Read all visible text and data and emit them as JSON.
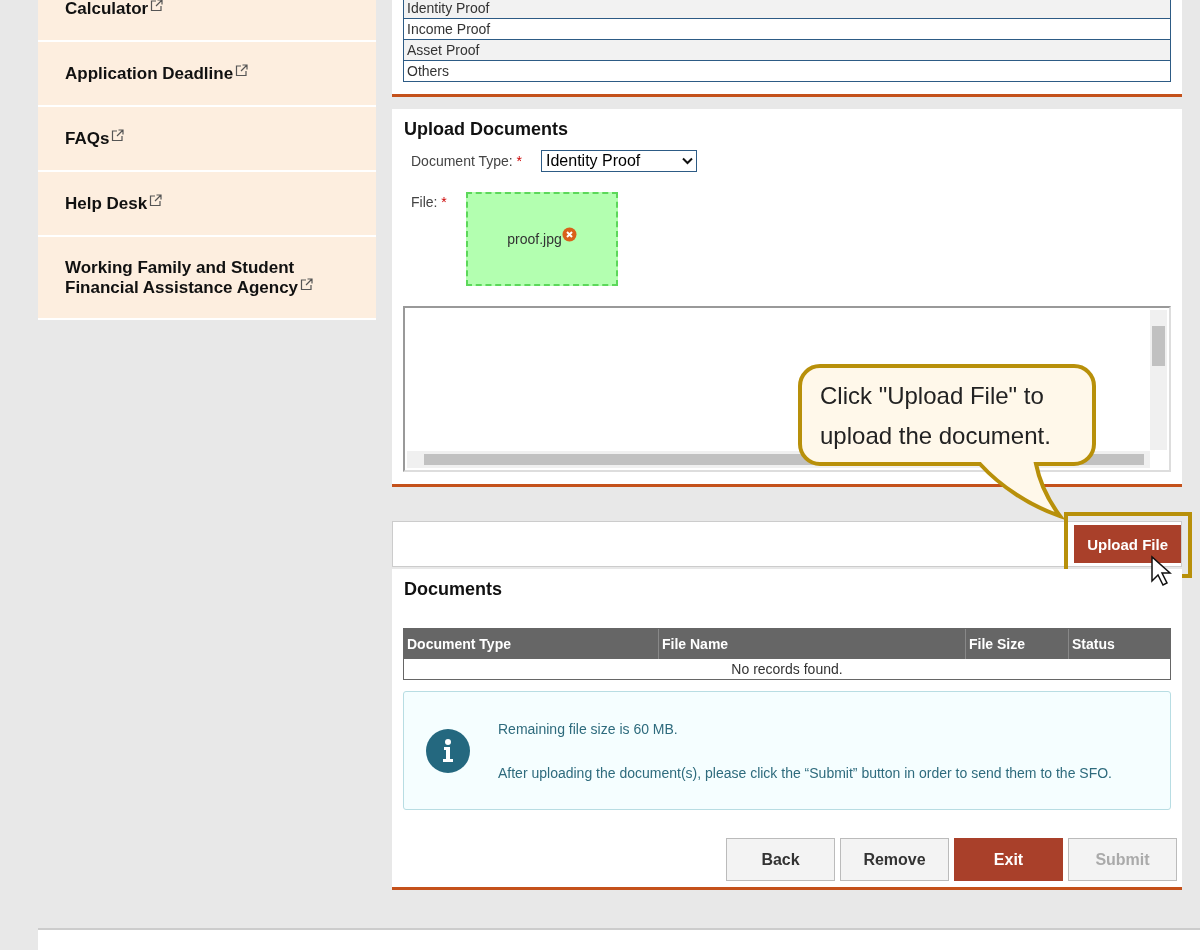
{
  "sidebar": {
    "items": [
      {
        "label": "Calculator"
      },
      {
        "label": "Application Deadline"
      },
      {
        "label": "FAQs"
      },
      {
        "label": "Help Desk"
      },
      {
        "label": "Working Family and Student Financial Assistance Agency"
      }
    ]
  },
  "document_types_table": {
    "rows": [
      "Identity Proof",
      "Income Proof",
      "Asset Proof",
      "Others"
    ]
  },
  "upload_documents": {
    "title": "Upload Documents",
    "document_type_label": "Document Type:",
    "document_type_value": "Identity Proof",
    "file_label": "File:",
    "required_mark": "*",
    "file_name": "proof.jpg"
  },
  "upload_button": "Upload File",
  "callout": "Click \"Upload File\" to upload the document.",
  "documents": {
    "title": "Documents",
    "columns": [
      "Document Type",
      "File Name",
      "File Size",
      "Status"
    ],
    "empty_message": "No records found."
  },
  "info": {
    "lines": [
      "Remaining file size is 60 MB.",
      "After uploading the document(s), please click the “Submit” button in order to send them to the SFO."
    ]
  },
  "buttons": [
    {
      "label": "Back",
      "kind": "default",
      "disabled": false
    },
    {
      "label": "Remove",
      "kind": "default",
      "disabled": false
    },
    {
      "label": "Exit",
      "kind": "primary",
      "disabled": false
    },
    {
      "label": "Submit",
      "kind": "default",
      "disabled": true
    }
  ]
}
